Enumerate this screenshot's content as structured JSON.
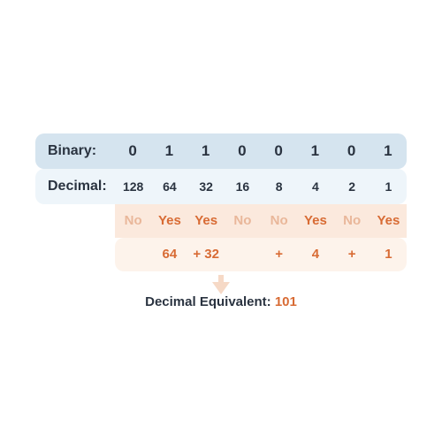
{
  "labels": {
    "binary": "Binary:",
    "decimal": "Decimal:",
    "result_label": "Decimal Equivalent: ",
    "result_value": "101"
  },
  "binary_bits": [
    "0",
    "1",
    "1",
    "0",
    "0",
    "1",
    "0",
    "1"
  ],
  "place_values": [
    "128",
    "64",
    "32",
    "16",
    "8",
    "4",
    "2",
    "1"
  ],
  "yesno": [
    "No",
    "Yes",
    "Yes",
    "No",
    "No",
    "Yes",
    "No",
    "Yes"
  ],
  "sum_cells": [
    "",
    "64",
    "+  32",
    "",
    "+",
    "4",
    "+",
    "1"
  ]
}
